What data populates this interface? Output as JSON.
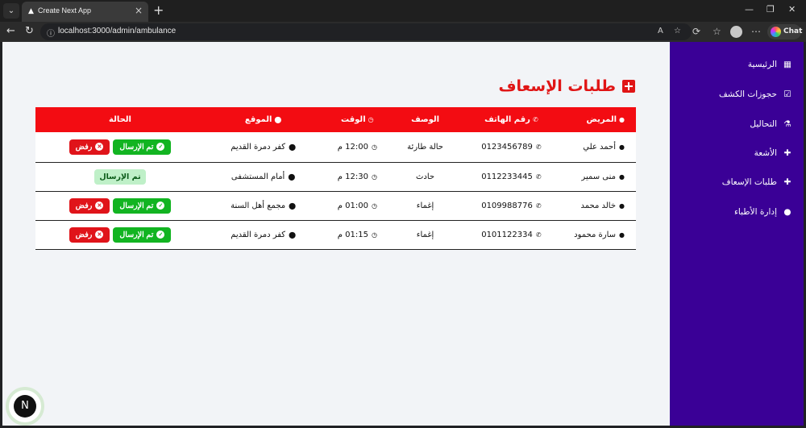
{
  "browser": {
    "tab_title": "Create Next App",
    "url": "localhost:3000/admin/ambulance",
    "chat_label": "Chat",
    "favicon": "▲"
  },
  "sidebar": {
    "items": [
      {
        "label": "الرئيسية",
        "icon": "dashboard-icon",
        "glyph": "▦"
      },
      {
        "label": "حجوزات الكشف",
        "icon": "calendar-check-icon",
        "glyph": "☑"
      },
      {
        "label": "التحاليل",
        "icon": "flask-icon",
        "glyph": "⚗"
      },
      {
        "label": "الأشعة",
        "icon": "medkit-icon",
        "glyph": "✚"
      },
      {
        "label": "طلبات الإسعاف",
        "icon": "plus-square-icon",
        "glyph": "✚"
      },
      {
        "label": "إدارة الأطباء",
        "icon": "user-icon",
        "glyph": "●"
      }
    ]
  },
  "main": {
    "title": "طلبات الإسعاف"
  },
  "table": {
    "headers": {
      "patient": "المريض",
      "phone": "رقم الهاتف",
      "description": "الوصف",
      "time": "الوقت",
      "location": "الموقع",
      "status": "الحالة"
    },
    "rows": [
      {
        "patient": "أحمد علي",
        "phone": "0123456789",
        "description": "حالة طارئة",
        "time": "12:00 م",
        "location": "كفر دمرة القديم",
        "status": "pending"
      },
      {
        "patient": "منى سمير",
        "phone": "0112233445",
        "description": "حادث",
        "time": "12:30 م",
        "location": "أمام المستشفى",
        "status": "sent"
      },
      {
        "patient": "خالد محمد",
        "phone": "0109988776",
        "description": "إغماء",
        "time": "01:00 م",
        "location": "مجمع أهل السنة",
        "status": "pending"
      },
      {
        "patient": "سارة محمود",
        "phone": "0101122334",
        "description": "إغماء",
        "time": "01:15 م",
        "location": "كفر دمرة القديم",
        "status": "pending"
      }
    ],
    "actions": {
      "sent_label": "تم الإرسال",
      "reject_label": "رفض",
      "sent_badge": "تم الإرسال"
    }
  },
  "colors": {
    "sidebar_bg": "#3a0096",
    "header_red": "#f30c12",
    "sent_green": "#12b421",
    "reject_red": "#e0141a"
  },
  "next_badge": "N"
}
